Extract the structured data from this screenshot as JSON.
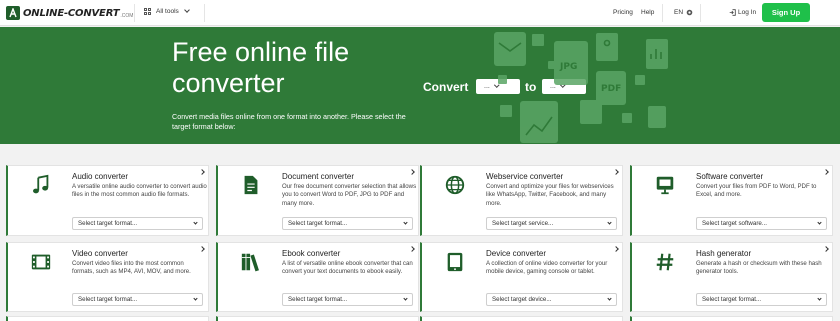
{
  "nav": {
    "logo_text": "ONLINE-CONVERT",
    "logo_suffix": ".COM",
    "all_tools": "All tools",
    "pricing": "Pricing",
    "help": "Help",
    "language": "EN",
    "login": "Log In",
    "signup": "Sign Up"
  },
  "hero": {
    "title": "Free online file converter",
    "subtitle": "Convert media files online from one format into another. Please select the target format below:",
    "convert_label": "Convert",
    "to_label": "to",
    "from_select": "...",
    "to_select": "...",
    "illustration_labels": [
      "JPG",
      "PDF"
    ]
  },
  "cards": [
    {
      "title": "Audio converter",
      "desc": "A versatile online audio converter to convert audio files in the most common audio file formats.",
      "select": "Select target format...",
      "icon": "music-note-icon"
    },
    {
      "title": "Document converter",
      "desc": "Our free document converter selection that allows you to convert Word to PDF, JPG to PDF and many more.",
      "select": "Select target format...",
      "icon": "document-icon"
    },
    {
      "title": "Webservice converter",
      "desc": "Convert and optimize your files for webservices like WhatsApp, Twitter, Facebook, and many more.",
      "select": "Select target service...",
      "icon": "globe-icon"
    },
    {
      "title": "Software converter",
      "desc": "Convert your files from PDF to Word, PDF to Excel, and more.",
      "select": "Select target software...",
      "icon": "monitor-icon"
    },
    {
      "title": "Video converter",
      "desc": "Convert video files into the most common formats, such as MP4, AVI, MOV, and more.",
      "select": "Select target format...",
      "icon": "film-icon"
    },
    {
      "title": "Ebook converter",
      "desc": "A list of versatile online ebook converter that can convert your text documents to ebook easily.",
      "select": "Select target format...",
      "icon": "books-icon"
    },
    {
      "title": "Device converter",
      "desc": "A collection of online video converter for your mobile device, gaming console or tablet.",
      "select": "Select target device...",
      "icon": "tablet-icon"
    },
    {
      "title": "Hash generator",
      "desc": "Generate a hash or checksum with these hash generator tools.",
      "select": "Select target format...",
      "icon": "hash-icon"
    }
  ],
  "colors": {
    "brand_green": "#2f7a38",
    "signup_green": "#1fc04a",
    "icon_green": "#1f5d2a"
  }
}
